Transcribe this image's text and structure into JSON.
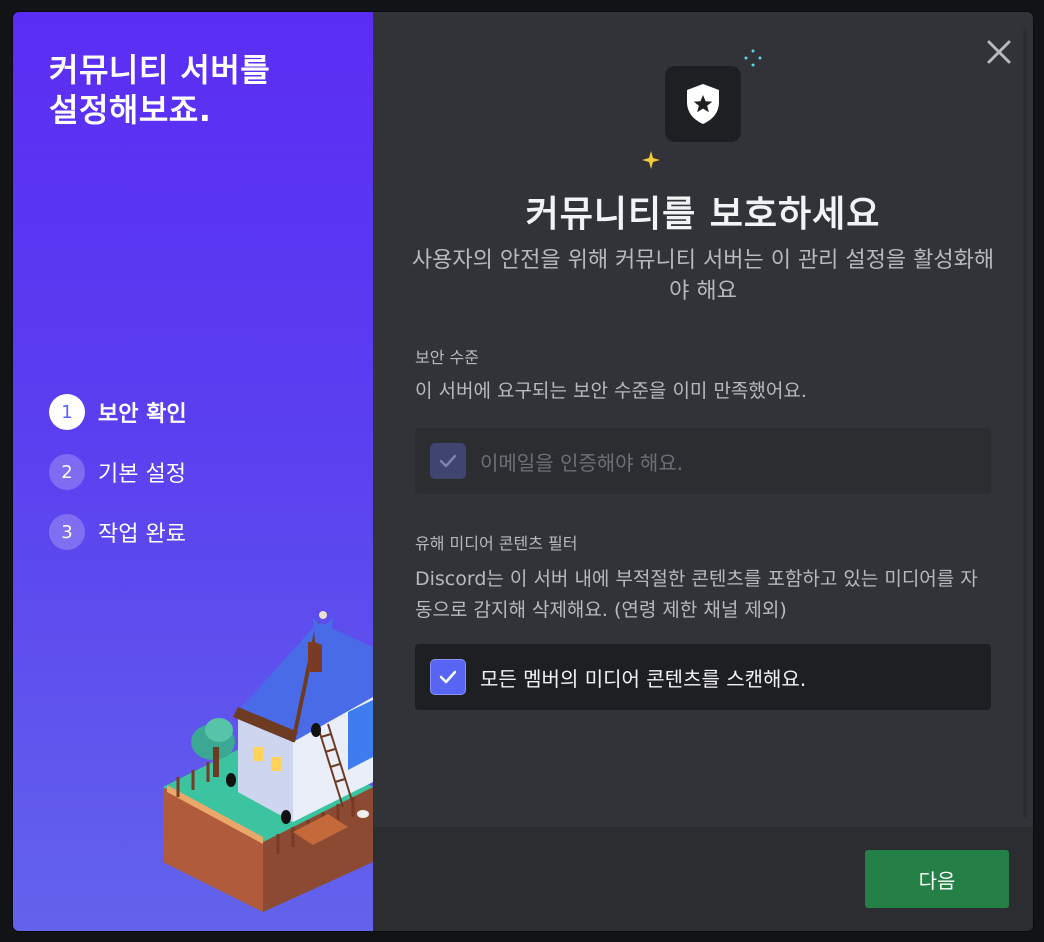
{
  "left": {
    "title": "커뮤니티 서버를\n설정해보죠.",
    "steps": [
      {
        "num": "1",
        "label": "보안 확인",
        "active": true
      },
      {
        "num": "2",
        "label": "기본 설정",
        "active": false
      },
      {
        "num": "3",
        "label": "작업 완료",
        "active": false
      }
    ]
  },
  "right": {
    "title": "커뮤니티를 보호하세요",
    "subtitle": "사용자의 안전을 위해 커뮤니티 서버는 이 관리 설정을 활성화해야 해요",
    "security": {
      "label": "보안 수준",
      "description": "이 서버에 요구되는 보안 수준을 이미 만족했어요.",
      "checkbox_label": "이메일을 인증해야 해요.",
      "checked": true,
      "disabled": true
    },
    "media_filter": {
      "label": "유해 미디어 콘텐츠 필터",
      "description": "Discord는 이 서버 내에 부적절한 콘텐츠를 포함하고 있는 미디어를 자동으로 감지해 삭제해요. (연령 제한 채널 제외)",
      "checkbox_label": "모든 멤버의 미디어 콘텐츠를 스캔해요.",
      "checked": true
    },
    "next_button": "다음"
  },
  "icons": {
    "close": "close-icon",
    "shield": "shield-star-icon",
    "check": "check-icon"
  },
  "colors": {
    "accent": "#5865f2",
    "success": "#248046",
    "left_gradient_top": "#5b2df4",
    "left_gradient_bottom": "#6363ec",
    "panel": "#313338",
    "footer": "#2b2d31"
  }
}
